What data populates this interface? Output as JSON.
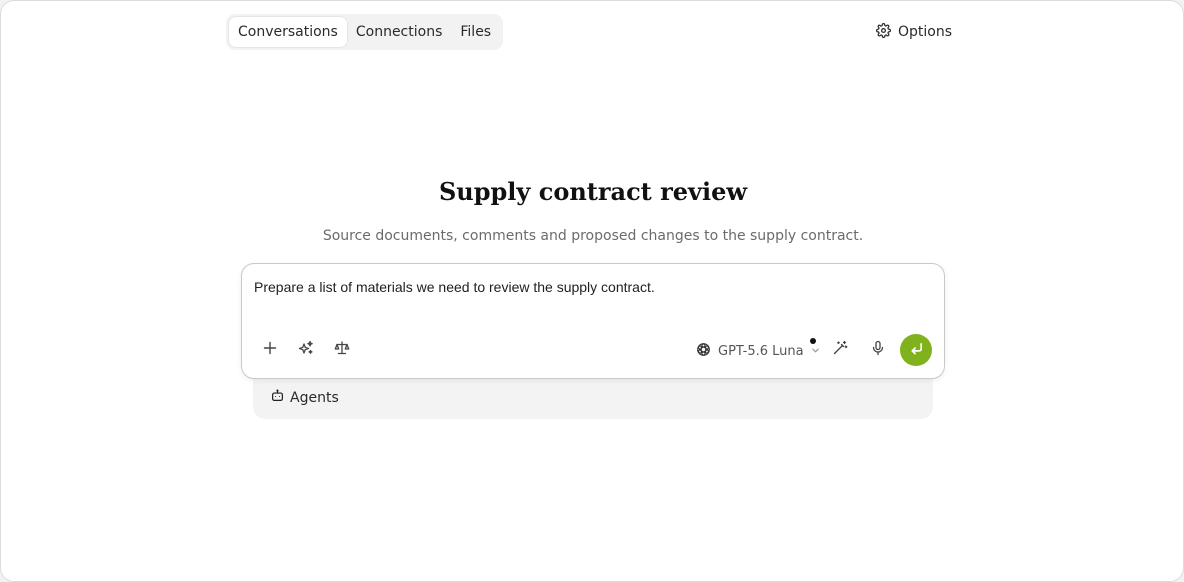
{
  "nav": {
    "tabs": [
      {
        "label": "Conversations",
        "active": true
      },
      {
        "label": "Connections",
        "active": false
      },
      {
        "label": "Files",
        "active": false
      }
    ],
    "options_label": "Options",
    "options_icon": "gear-icon"
  },
  "main": {
    "title": "Supply contract review",
    "subtitle": "Source documents, comments and proposed changes to the supply contract."
  },
  "composer": {
    "prompt_value": "Prepare a list of materials we need to review the supply contract.",
    "left_icons": [
      "plus-icon",
      "sparkles-icon",
      "scales-icon"
    ],
    "model_label": "GPT-5.6 Luna",
    "model_icon": "openai-logo-icon",
    "right_icons": [
      "magic-wand-icon",
      "microphone-icon"
    ],
    "send_icon": "enter-arrow-icon",
    "send_color": "#7fb21c"
  },
  "agents": {
    "label": "Agents",
    "icon": "robot-icon"
  }
}
